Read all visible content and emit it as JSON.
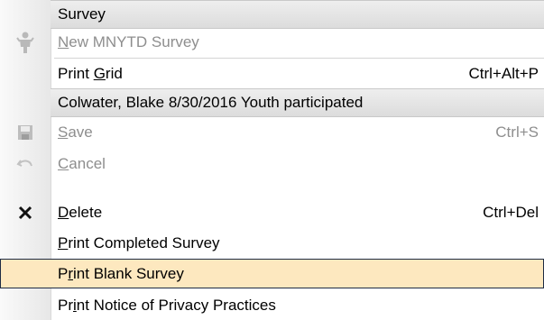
{
  "menu": {
    "groups": [
      {
        "header": "Survey",
        "items": [
          {
            "mnemonic_pre": "",
            "mnemonic": "N",
            "mnemonic_post": "ew MNYTD Survey",
            "shortcut": "",
            "icon": "survey-person-icon",
            "disabled": true
          },
          {
            "mnemonic_pre": "Print ",
            "mnemonic": "G",
            "mnemonic_post": "rid",
            "shortcut": "Ctrl+Alt+P",
            "icon": "",
            "disabled": false
          }
        ]
      },
      {
        "header": "Colwater, Blake 8/30/2016 Youth participated",
        "items": [
          {
            "mnemonic_pre": "",
            "mnemonic": "S",
            "mnemonic_post": "ave",
            "shortcut": "Ctrl+S",
            "icon": "save-icon",
            "disabled": true
          },
          {
            "mnemonic_pre": "",
            "mnemonic": "C",
            "mnemonic_post": "ancel",
            "shortcut": "",
            "icon": "undo-icon",
            "disabled": true
          },
          {
            "mnemonic_pre": "",
            "mnemonic": "D",
            "mnemonic_post": "elete",
            "shortcut": "Ctrl+Del",
            "icon": "delete-x-icon",
            "disabled": false
          },
          {
            "mnemonic_pre": "",
            "mnemonic": "P",
            "mnemonic_post": "rint Completed Survey",
            "shortcut": "",
            "icon": "",
            "disabled": false
          },
          {
            "mnemonic_pre": "P",
            "mnemonic": "r",
            "mnemonic_post": "int Blank Survey",
            "shortcut": "",
            "icon": "",
            "disabled": false,
            "highlighted": true
          },
          {
            "mnemonic_pre": "Pr",
            "mnemonic": "i",
            "mnemonic_post": "nt Notice of Privacy Practices",
            "shortcut": "",
            "icon": "",
            "disabled": false
          }
        ]
      }
    ]
  },
  "colors": {
    "highlight": "#fde8bf",
    "highlight_border": "#1f2c44",
    "disabled_text": "#8e8e8e",
    "header_bg": "#e4e4e4"
  }
}
